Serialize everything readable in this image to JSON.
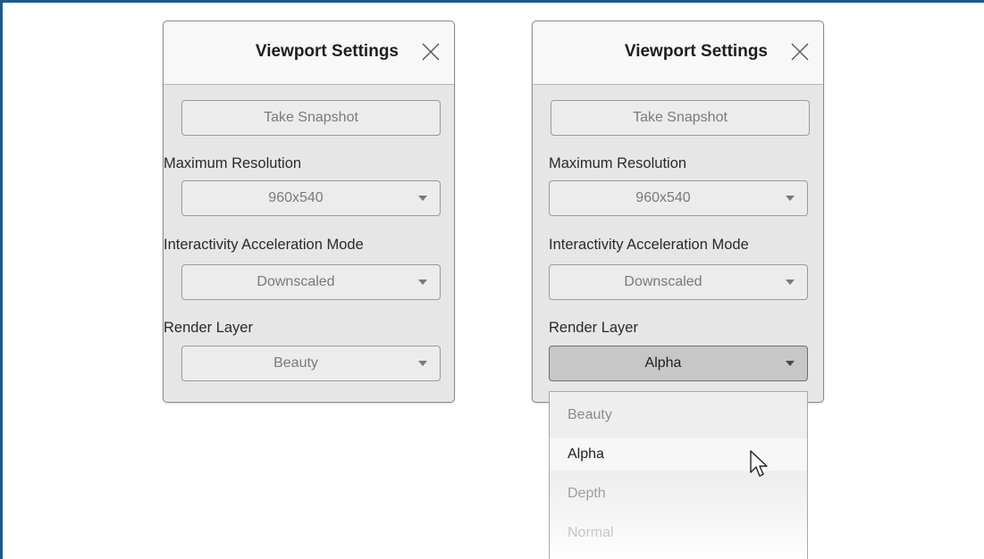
{
  "panels": [
    {
      "title": "Viewport Settings",
      "snapshot_label": "Take Snapshot",
      "max_res_label": "Maximum Resolution",
      "max_res_value": "960x540",
      "accel_label": "Interactivity Acceleration Mode",
      "accel_value": "Downscaled",
      "layer_label": "Render Layer",
      "layer_value": "Beauty"
    },
    {
      "title": "Viewport Settings",
      "snapshot_label": "Take Snapshot",
      "max_res_label": "Maximum Resolution",
      "max_res_value": "960x540",
      "accel_label": "Interactivity Acceleration Mode",
      "accel_value": "Downscaled",
      "layer_label": "Render Layer",
      "layer_value": "Alpha"
    }
  ],
  "dropdown": {
    "items": [
      "Beauty",
      "Alpha",
      "Depth",
      "Normal"
    ],
    "item_colors": [
      "#8c8c8c",
      "#1e1e1e",
      "#9e9e9e",
      "#c6c6c6"
    ],
    "hovered_index": 1
  },
  "icons": {
    "close": "close-icon",
    "select_arrow": "chevron-down-icon",
    "cursor": "mouse-pointer-icon"
  },
  "colors": {
    "frame": "#1b5a8c",
    "panel_bg": "#e6e6e6",
    "header_bg": "#f8f8f8",
    "open_select_bg": "#c7c7c7"
  }
}
